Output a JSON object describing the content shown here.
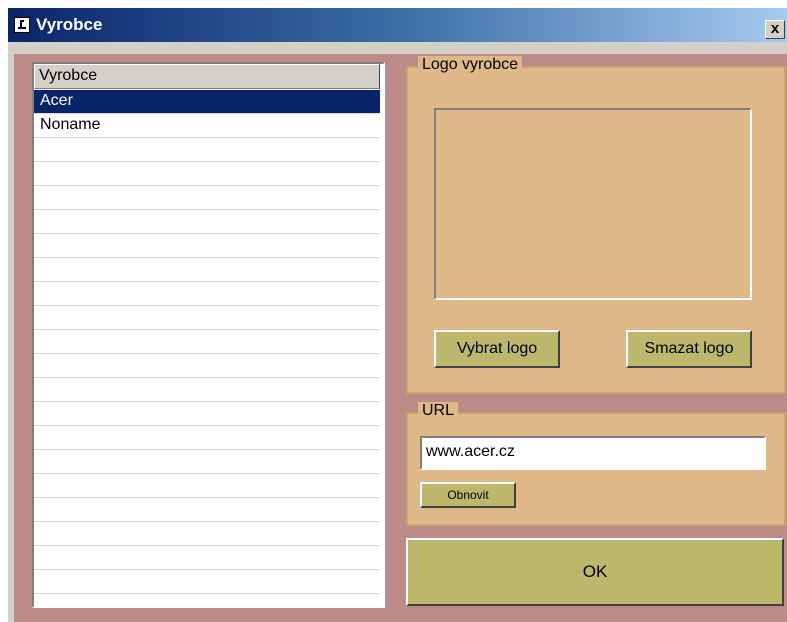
{
  "window": {
    "title": "Vyrobce",
    "close_label": "x"
  },
  "list": {
    "header": "Vyrobce",
    "items": [
      "Acer",
      "Noname",
      "",
      "",
      "",
      "",
      "",
      "",
      "",
      "",
      "",
      "",
      "",
      "",
      "",
      "",
      "",
      "",
      "",
      "",
      "",
      ""
    ],
    "selected_index": 0
  },
  "logo_group": {
    "legend": "Logo vyrobce",
    "select_button": "Vybrat logo",
    "delete_button": "Smazat logo"
  },
  "url_group": {
    "legend": "URL",
    "url_value": "www.acer.cz",
    "refresh_button": "Obnovit"
  },
  "ok_button": "OK",
  "colors": {
    "client_bg": "#bc8a87",
    "group_bg": "#deb887",
    "button_bg": "#bdb76b",
    "selection": "#0a246a"
  }
}
